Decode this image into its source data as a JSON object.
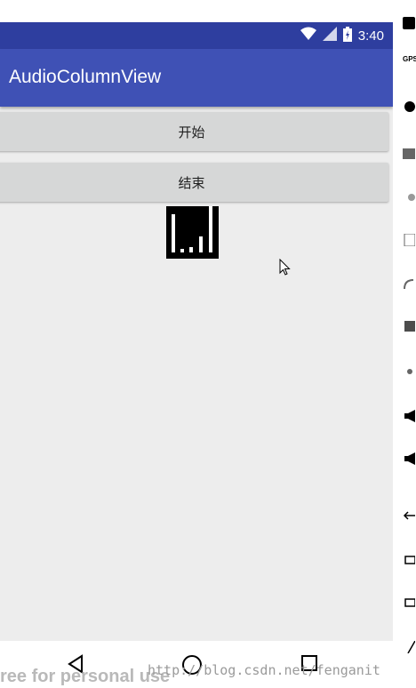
{
  "status_bar": {
    "time": "3:40"
  },
  "app_bar": {
    "title": "AudioColumnView"
  },
  "buttons": {
    "start_label": "开始",
    "end_label": "结束"
  },
  "watermark": {
    "url": "http://blog.csdn.net/fenganit",
    "free_text": "ree for personal use"
  },
  "colors": {
    "primary": "#3f51b5",
    "primary_dark": "#2e3e9f",
    "background": "#ededed",
    "button": "#d6d7d7"
  },
  "side_toolbar": {
    "gps_label": "GPS"
  }
}
